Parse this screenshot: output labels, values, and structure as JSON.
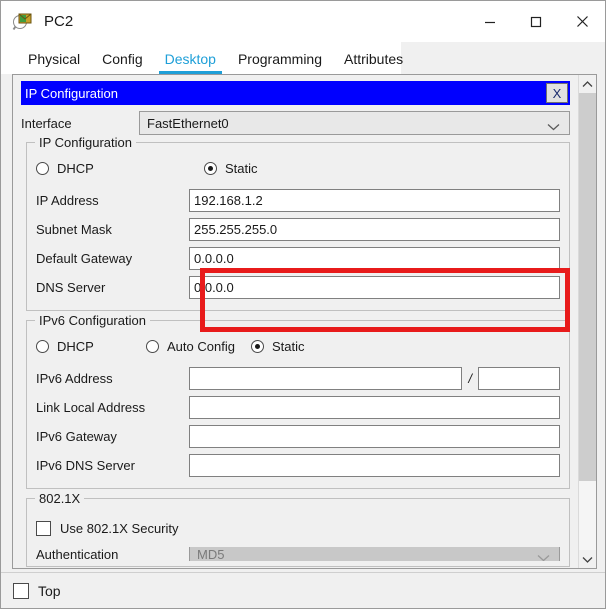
{
  "window": {
    "title": "PC2",
    "icon": "packet-tracer-pc-icon",
    "minimize_label": "Minimize",
    "maximize_label": "Maximize",
    "close_label": "Close"
  },
  "tabs": [
    {
      "label": "Physical",
      "active": false
    },
    {
      "label": "Config",
      "active": false
    },
    {
      "label": "Desktop",
      "active": true
    },
    {
      "label": "Programming",
      "active": false
    },
    {
      "label": "Attributes",
      "active": false
    }
  ],
  "panel": {
    "header_title": "IP Configuration",
    "close_button_label": "X",
    "header_bg": "#0000ff"
  },
  "interface": {
    "label": "Interface",
    "value": "FastEthernet0"
  },
  "ip_configuration": {
    "group_title": "IP Configuration",
    "mode_dhcp": "DHCP",
    "mode_static": "Static",
    "selected_mode": "Static",
    "fields": [
      {
        "label": "IP Address",
        "value": "192.168.1.2",
        "highlighted": true
      },
      {
        "label": "Subnet Mask",
        "value": "255.255.255.0",
        "highlighted": true
      },
      {
        "label": "Default Gateway",
        "value": "0.0.0.0",
        "highlighted": false
      },
      {
        "label": "DNS Server",
        "value": "0.0.0.0",
        "highlighted": false
      }
    ]
  },
  "ipv6_configuration": {
    "group_title": "IPv6 Configuration",
    "mode_dhcp": "DHCP",
    "mode_auto": "Auto Config",
    "mode_static": "Static",
    "selected_mode": "Static",
    "address_label": "IPv6 Address",
    "address_value": "",
    "prefix_separator": "/",
    "prefix_value": "",
    "fields": [
      {
        "label": "Link Local Address",
        "value": ""
      },
      {
        "label": "IPv6 Gateway",
        "value": ""
      },
      {
        "label": "IPv6 DNS Server",
        "value": ""
      }
    ]
  },
  "dot1x": {
    "group_title": "802.1X",
    "use_security_label": "Use 802.1X Security",
    "use_security_checked": false,
    "authentication_label": "Authentication",
    "authentication_value": "MD5"
  },
  "bottom": {
    "top_label": "Top",
    "top_checked": false
  },
  "annotation": {
    "highlight_color": "#e81b1b"
  }
}
